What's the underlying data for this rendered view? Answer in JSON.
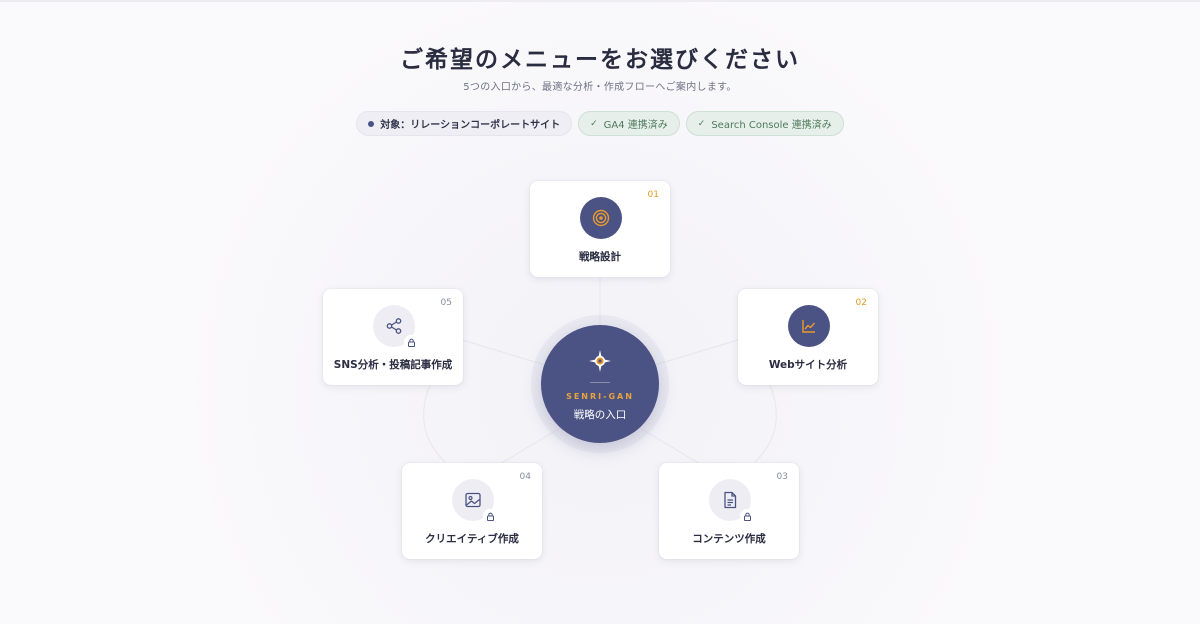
{
  "header": {
    "title": "ご希望のメニューをお選びください",
    "subtitle": "5つの入口から、最適な分析・作成フローへご案内します。"
  },
  "chips": {
    "target": "対象：リレーションコーポレートサイト",
    "ga4": "GA4 連携済み",
    "search_console": "Search Console 連携済み"
  },
  "hub": {
    "brand": "SENRI-GAN",
    "title": "戦略の入口",
    "accent": "#e8a33a",
    "background": "#4b5384"
  },
  "menu": [
    {
      "number": "01",
      "label": "戦略設計",
      "icon": "target-icon",
      "locked": false
    },
    {
      "number": "02",
      "label": "Webサイト分析",
      "icon": "line-chart-icon",
      "locked": false
    },
    {
      "number": "03",
      "label": "コンテンツ作成",
      "icon": "document-icon",
      "locked": true
    },
    {
      "number": "04",
      "label": "クリエイティブ作成",
      "icon": "image-icon",
      "locked": true
    },
    {
      "number": "05",
      "label": "SNS分析・投稿記事作成",
      "icon": "share-icon",
      "locked": true
    }
  ]
}
